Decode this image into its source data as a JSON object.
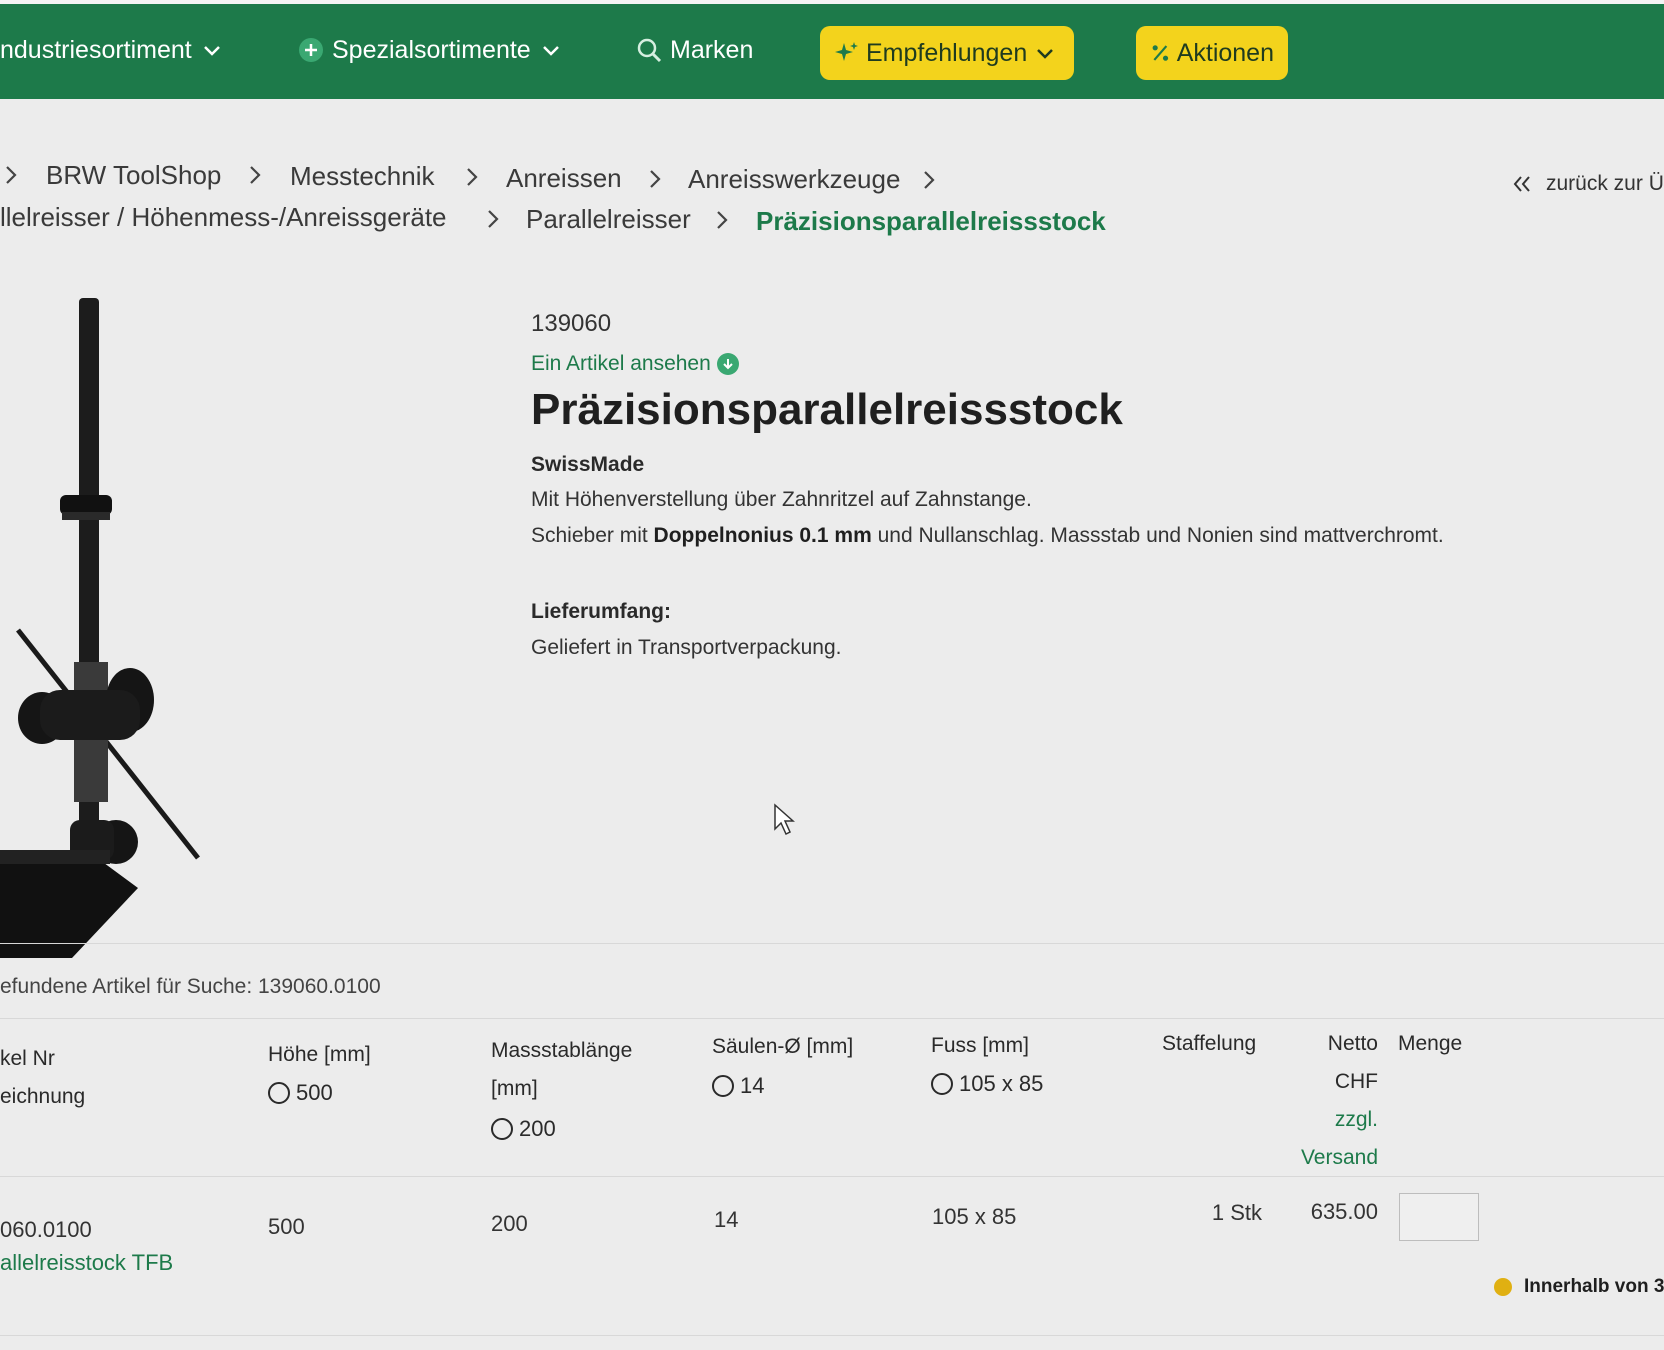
{
  "nav": {
    "items": [
      {
        "label": "ndustriesortiment",
        "icon": "chevron-down-icon"
      },
      {
        "label": "Spezialsortimente",
        "icon": "plus-circle-icon"
      },
      {
        "label": "Marken",
        "icon": "search-icon"
      }
    ],
    "recommendations": "Empfehlungen",
    "actions": "Aktionen"
  },
  "breadcrumb": {
    "items": [
      "BRW ToolShop",
      "Messtechnik",
      "Anreissen",
      "Anreisswerkzeuge",
      "llelreisser / Höhenmess-/Anreissgeräte",
      "Parallelreisser"
    ],
    "current": "Präzisionsparallelreissstock",
    "back": "zurück zur Ü"
  },
  "product": {
    "article_number": "139060",
    "view_link": "Ein Artikel ansehen",
    "title": "Präzisionsparallelreissstock",
    "brand": "SwissMade",
    "desc_line1": "Mit Höhenverstellung über Zahnritzel auf Zahnstange.",
    "desc_line2_pre": "Schieber mit ",
    "desc_line2_bold": "Doppelnonius 0.1 mm",
    "desc_line2_post": " und Nullanschlag. Massstab und Nonien sind mattverchromt.",
    "scope_heading": "Lieferumfang:",
    "scope_text": "Geliefert in Transportverpackung."
  },
  "search": {
    "found_text": "efundene Artikel für Suche: 139060.0100"
  },
  "table": {
    "headers": {
      "article_line1": "kel Nr",
      "article_line2": "eichnung",
      "height": "Höhe [mm]",
      "scale_line1": "Massstablänge",
      "scale_line2": "[mm]",
      "column": "Säulen-Ø [mm]",
      "foot": "Fuss [mm]",
      "tiering": "Staffelung",
      "net_line1": "Netto",
      "net_line2": "CHF",
      "net_line3": "zzgl.",
      "net_line4": "Versand",
      "qty": "Menge"
    },
    "filters": {
      "height": "500",
      "scale": "200",
      "column": "14",
      "foot": "105 x 85"
    },
    "row": {
      "article_number": "060.0100",
      "article_name": "allelreisstock TFB",
      "height": "500",
      "scale": "200",
      "column": "14",
      "foot": "105 x 85",
      "tiering": "1 Stk",
      "price": "635.00",
      "qty": ""
    },
    "availability": "Innerhalb von 3"
  },
  "colors": {
    "brand_green": "#1d7a4a",
    "accent_yellow": "#f3d31c",
    "availability_dot": "#e0b012"
  }
}
